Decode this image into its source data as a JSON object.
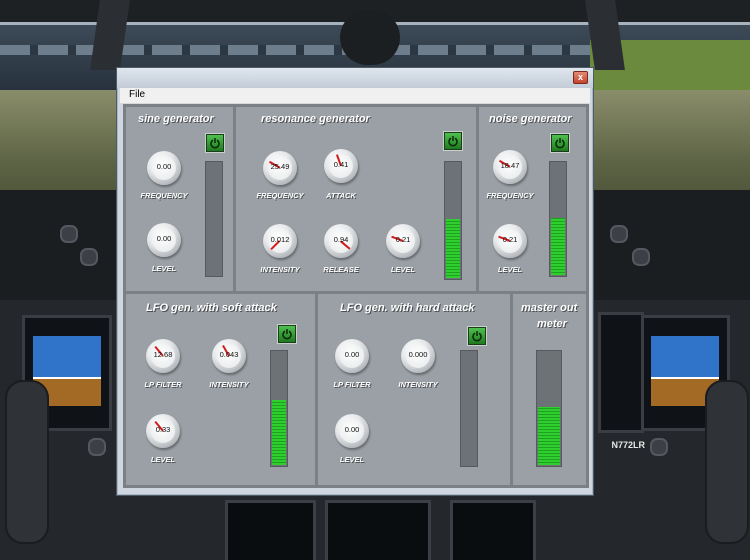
{
  "window": {
    "close_glyph": "x",
    "menu": {
      "file": "File"
    }
  },
  "background": {
    "tail_registration": "N772LR"
  },
  "sine": {
    "title": "sine generator",
    "frequency": {
      "label": "FREQUENCY",
      "value": "0.00"
    },
    "level": {
      "label": "LEVEL",
      "value": "0.00"
    },
    "meter_level": 0.0,
    "power_icon": "power-icon"
  },
  "resonance": {
    "title": "resonance generator",
    "frequency": {
      "label": "FREQUENCY",
      "value": "25.49"
    },
    "attack": {
      "label": "ATTACK",
      "value": "0.41"
    },
    "intensity": {
      "label": "INTENSITY",
      "value": "0.012"
    },
    "release": {
      "label": "RELEASE",
      "value": "0.94"
    },
    "level": {
      "label": "LEVEL",
      "value": "0.21"
    },
    "meter_level": 0.52
  },
  "noise": {
    "title": "noise generator",
    "frequency": {
      "label": "FREQUENCY",
      "value": "18.47"
    },
    "level": {
      "label": "LEVEL",
      "value": "0.21"
    },
    "meter_level": 0.52
  },
  "lfo_soft": {
    "title": "LFO gen. with soft attack",
    "lp_filter": {
      "label": "LP FILTER",
      "value": "12.68"
    },
    "intensity": {
      "label": "INTENSITY",
      "value": "0.043"
    },
    "level": {
      "label": "LEVEL",
      "value": "0.33"
    },
    "meter_level": 0.58
  },
  "lfo_hard": {
    "title": "LFO gen. with hard attack",
    "lp_filter": {
      "label": "LP FILTER",
      "value": "0.00"
    },
    "intensity": {
      "label": "INTENSITY",
      "value": "0.000"
    },
    "level": {
      "label": "LEVEL",
      "value": "0.00"
    },
    "meter_level": 0.0
  },
  "master": {
    "title_line1": "master out",
    "title_line2": "meter",
    "meter_level": 0.52
  },
  "colors": {
    "panel": "#9aa0a5",
    "meter_green": "#2fcf2f",
    "power_green": "#2e9e2e",
    "needle_red": "#d21b1b"
  }
}
